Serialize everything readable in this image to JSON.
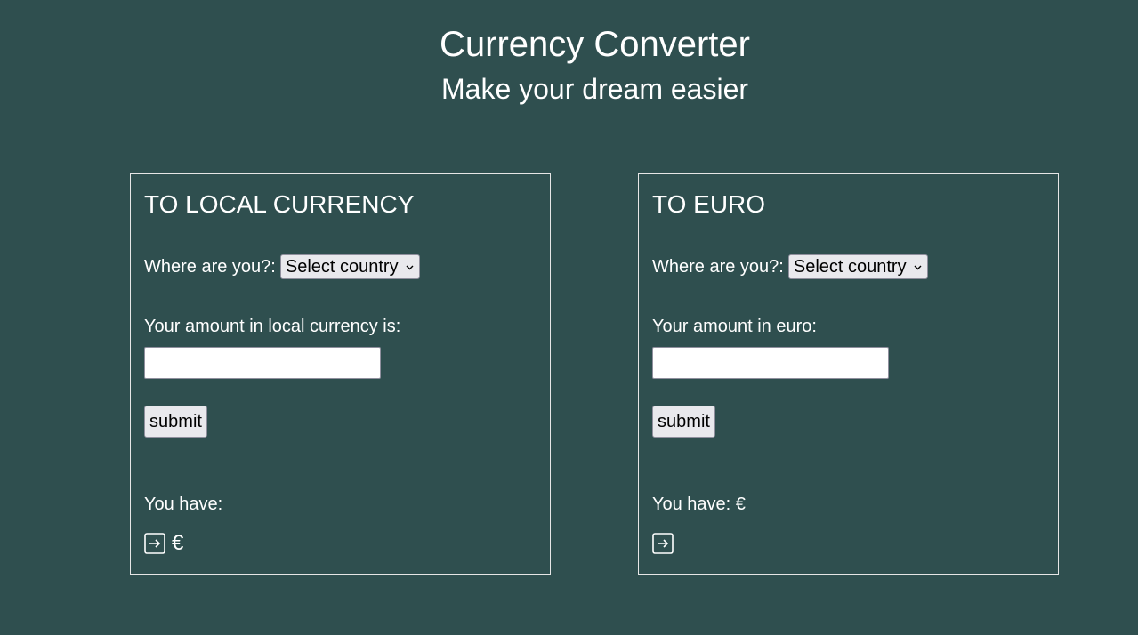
{
  "header": {
    "title": "Currency Converter",
    "subtitle": "Make your dream easier"
  },
  "panels": {
    "to_local": {
      "title": "TO LOCAL CURRENCY",
      "country_label": "Where are you?:",
      "country_select": "Select country",
      "amount_label": "Your amount in local currency is:",
      "amount_value": "",
      "submit_label": "submit",
      "result_label": "You have:",
      "result_icon": "enter-icon",
      "result_currency": "€"
    },
    "to_euro": {
      "title": "TO EURO",
      "country_label": "Where are you?:",
      "country_select": "Select country",
      "amount_label": "Your amount in euro:",
      "amount_value": "",
      "submit_label": "submit",
      "result_label": "You have: €",
      "result_icon": "enter-icon"
    }
  },
  "colors": {
    "background": "#2f4f4f",
    "text": "#ffffff",
    "panel_border": "#e6e6e6",
    "control_bg": "#e9e9ed"
  }
}
